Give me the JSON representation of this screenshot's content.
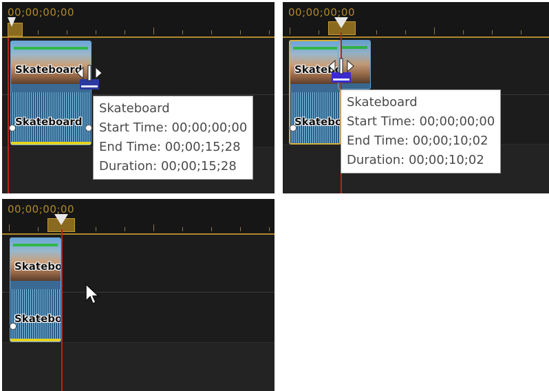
{
  "panels": [
    {
      "timecode": "00;00;00;00",
      "clip_label": "Skateboard",
      "tooltip": {
        "name": "Skateboard",
        "start": "Start Time: 00;00;00;00",
        "end": "End Time: 00;00;15;28",
        "duration": "Duration: 00;00;15;28"
      }
    },
    {
      "timecode": "00;00;00;00",
      "clip_label": "Skateboard",
      "tooltip": {
        "name": "Skateboard",
        "start": "Start Time: 00;00;00;00",
        "end": "End Time: 00;00;10;02",
        "duration": "Duration: 00;00;10;02"
      }
    },
    {
      "timecode": "00;00;00;00",
      "clip_label": "Skateboard"
    }
  ],
  "colors": {
    "timeline_bg": "#1f1f1f",
    "ruler_accent": "#b08a2c",
    "playhead": "#c0201c",
    "clip_border": "#6fa8d8",
    "selected_border": "#d7b13a"
  },
  "icons": [
    "trim-cursor-icon",
    "arrow-cursor-icon",
    "playhead-handle-icon"
  ]
}
